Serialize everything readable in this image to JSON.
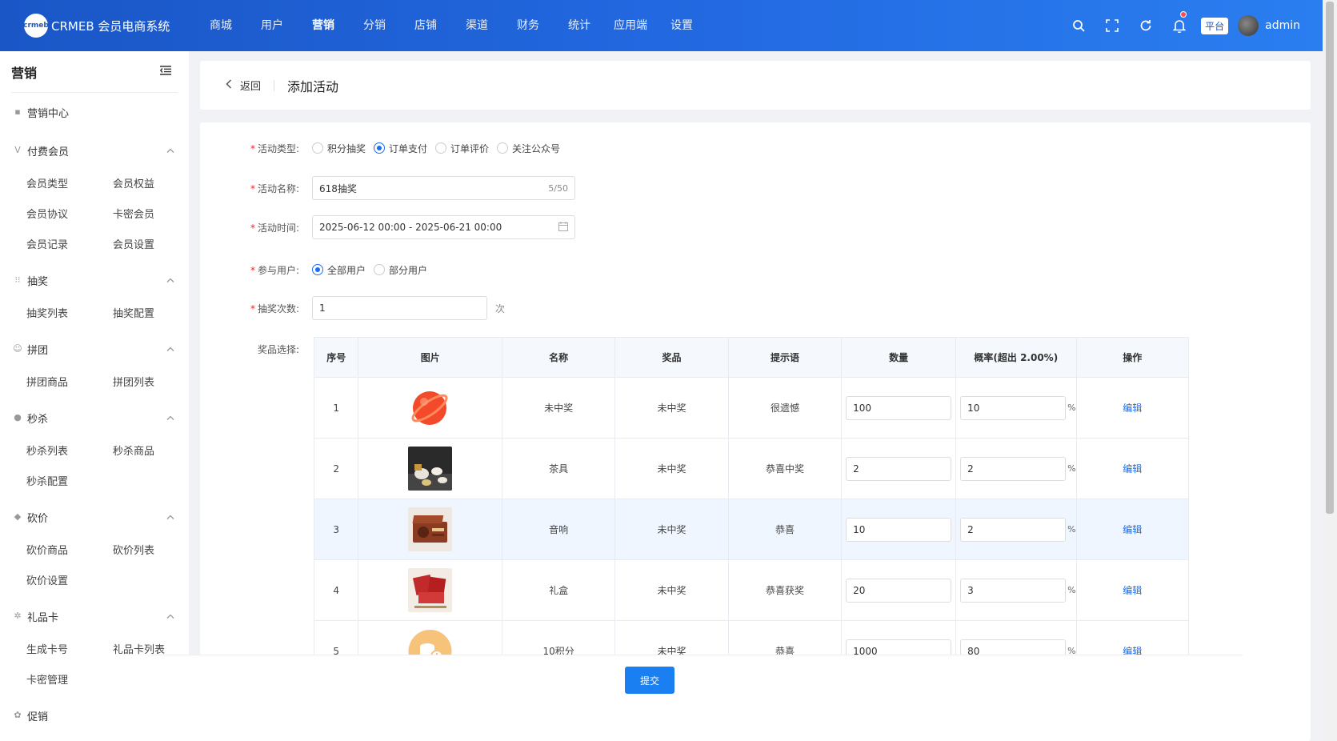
{
  "app": {
    "logo_badge": "crmeb",
    "title": "CRMEB 会员电商系统"
  },
  "topnav": [
    {
      "label": "商城"
    },
    {
      "label": "用户"
    },
    {
      "label": "营销"
    },
    {
      "label": "分销"
    },
    {
      "label": "店铺"
    },
    {
      "label": "渠道"
    },
    {
      "label": "财务"
    },
    {
      "label": "统计"
    },
    {
      "label": "应用端"
    },
    {
      "label": "设置"
    }
  ],
  "topnav_active": "营销",
  "topright": {
    "platform_badge": "平台",
    "username": "admin"
  },
  "sidebar": {
    "title": "营销",
    "sections": [
      {
        "label": "营销中心",
        "icon": "square-icon",
        "items": []
      },
      {
        "label": "付费会员",
        "icon": "v-icon",
        "items": [
          "会员类型",
          "会员权益",
          "会员协议",
          "卡密会员",
          "会员记录",
          "会员设置"
        ]
      },
      {
        "label": "抽奖",
        "icon": "grid-icon",
        "items": [
          "抽奖列表",
          "抽奖配置"
        ]
      },
      {
        "label": "拼团",
        "icon": "group-icon",
        "items": [
          "拼团商品",
          "拼团列表"
        ]
      },
      {
        "label": "秒杀",
        "icon": "clock-icon",
        "items": [
          "秒杀列表",
          "秒杀商品",
          "秒杀配置"
        ]
      },
      {
        "label": "砍价",
        "icon": "tag-icon",
        "items": [
          "砍价商品",
          "砍价列表",
          "砍价设置"
        ]
      },
      {
        "label": "礼品卡",
        "icon": "gear-icon",
        "items": [
          "生成卡号",
          "礼品卡列表",
          "卡密管理"
        ]
      },
      {
        "label": "促销",
        "icon": "flower-icon",
        "items": []
      }
    ]
  },
  "header": {
    "back_label": "返回",
    "page_title": "添加活动"
  },
  "form": {
    "activity_type": {
      "label": "活动类型:",
      "options": [
        "积分抽奖",
        "订单支付",
        "订单评价",
        "关注公众号"
      ],
      "selected": 1
    },
    "activity_name": {
      "label": "活动名称:",
      "value": "618抽奖",
      "count": "5/50"
    },
    "activity_time": {
      "label": "活动时间:",
      "value": "2025-06-12 00:00 - 2025-06-21 00:00"
    },
    "participants": {
      "label": "参与用户:",
      "options": [
        "全部用户",
        "部分用户"
      ],
      "selected": 0
    },
    "draw_times": {
      "label": "抽奖次数:",
      "value": "1",
      "suffix": "次"
    },
    "prizes_label": "奖品选择:"
  },
  "table": {
    "headers": [
      "序号",
      "图片",
      "名称",
      "奖品",
      "提示语",
      "数量",
      "概率(超出 2.00%)",
      "操作"
    ],
    "rows": [
      {
        "no": "1",
        "image": "red-planet-icon",
        "name": "未中奖",
        "prize": "未中奖",
        "tip": "很遗憾",
        "qty": "100",
        "rate": "10",
        "action": "编辑"
      },
      {
        "no": "2",
        "image": "tea-set-photo",
        "name": "茶具",
        "prize": "未中奖",
        "tip": "恭喜中奖",
        "qty": "2",
        "rate": "2",
        "action": "编辑"
      },
      {
        "no": "3",
        "image": "speaker-photo",
        "name": "音响",
        "prize": "未中奖",
        "tip": "恭喜",
        "qty": "10",
        "rate": "2",
        "action": "编辑"
      },
      {
        "no": "4",
        "image": "gift-box-photo",
        "name": "礼盒",
        "prize": "未中奖",
        "tip": "恭喜获奖",
        "qty": "20",
        "rate": "3",
        "action": "编辑"
      },
      {
        "no": "5",
        "image": "points-coin-icon",
        "name": "10积分",
        "prize": "未中奖",
        "tip": "恭喜",
        "qty": "1000",
        "rate": "80",
        "action": "编辑"
      }
    ],
    "percent_sign": "%"
  },
  "footer": {
    "submit_label": "提交"
  },
  "colors": {
    "brand": "#1a56c6",
    "accent": "#1a6ff0",
    "required": "#f5222d"
  }
}
